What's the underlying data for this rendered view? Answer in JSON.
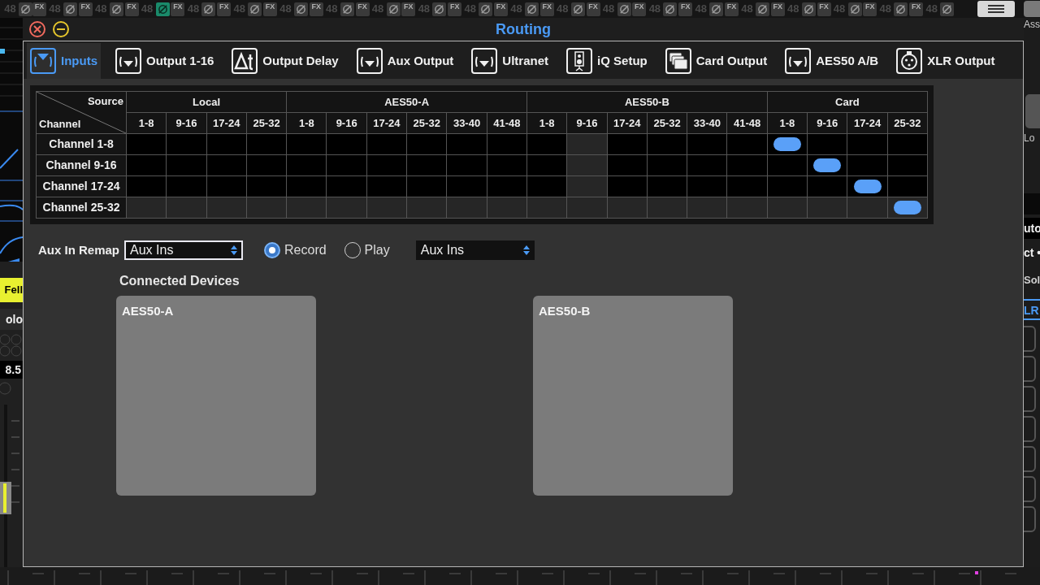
{
  "mixer_top": {
    "strips": [
      {
        "kind": "partial",
        "gain": "48",
        "phase_on": false
      },
      {
        "kind": "full",
        "fx": "FX",
        "gain": "48",
        "phase_on": false
      },
      {
        "kind": "full",
        "fx": "FX",
        "gain": "48",
        "phase_on": false
      },
      {
        "kind": "full",
        "fx": "FX",
        "gain": "48",
        "phase_on": true
      },
      {
        "kind": "full",
        "fx": "FX",
        "gain": "48",
        "phase_on": false
      },
      {
        "kind": "full",
        "fx": "FX",
        "gain": "48",
        "phase_on": false
      },
      {
        "kind": "full",
        "fx": "FX",
        "gain": "48",
        "phase_on": false
      },
      {
        "kind": "full",
        "fx": "FX",
        "gain": "48",
        "phase_on": false
      },
      {
        "kind": "full",
        "fx": "FX",
        "gain": "48",
        "phase_on": false
      },
      {
        "kind": "full",
        "fx": "FX",
        "gain": "48",
        "phase_on": false
      },
      {
        "kind": "full",
        "fx": "FX",
        "gain": "48",
        "phase_on": false
      },
      {
        "kind": "full",
        "fx": "FX",
        "gain": "48",
        "phase_on": false
      },
      {
        "kind": "full",
        "fx": "FX",
        "gain": "48",
        "phase_on": false
      },
      {
        "kind": "full",
        "fx": "FX",
        "gain": "48",
        "phase_on": false
      },
      {
        "kind": "full",
        "fx": "FX",
        "gain": "48",
        "phase_on": false
      },
      {
        "kind": "full",
        "fx": "FX",
        "gain": "48",
        "phase_on": false
      },
      {
        "kind": "full",
        "fx": "FX",
        "gain": "48",
        "phase_on": false
      },
      {
        "kind": "full",
        "fx": "FX",
        "gain": "48",
        "phase_on": false
      },
      {
        "kind": "full",
        "fx": "FX",
        "gain": "48",
        "phase_on": false
      },
      {
        "kind": "full",
        "fx": "FX",
        "gain": "48",
        "phase_on": false
      },
      {
        "kind": "full",
        "fx": "FX",
        "gain": "48",
        "phase_on": false
      }
    ]
  },
  "left_strip": {
    "channel_name": "Fell",
    "solo": "olo",
    "reading": "8.5"
  },
  "right_strip": {
    "assign": "Ass",
    "load": "Lo",
    "auto": "uto",
    "select": "ct •",
    "solo": "Sol",
    "bus": "LR"
  },
  "window": {
    "title": "Routing",
    "tabs": [
      {
        "label": "Inputs",
        "selected": true
      },
      {
        "label": "Output 1-16",
        "selected": false
      },
      {
        "label": "Output Delay",
        "selected": false
      },
      {
        "label": "Aux Output",
        "selected": false
      },
      {
        "label": "Ultranet",
        "selected": false
      },
      {
        "label": "iQ Setup",
        "selected": false
      },
      {
        "label": "Card Output",
        "selected": false
      },
      {
        "label": "AES50 A/B",
        "selected": false
      },
      {
        "label": "XLR Output",
        "selected": false
      }
    ],
    "matrix": {
      "corner": {
        "source": "Source",
        "channel": "Channel"
      },
      "groups": [
        {
          "label": "Local",
          "columns": [
            {
              "label": "1-8",
              "disabled": false
            },
            {
              "label": "9-16",
              "disabled": false
            },
            {
              "label": "17-24",
              "disabled": false
            },
            {
              "label": "25-32",
              "disabled": false
            }
          ]
        },
        {
          "label": "AES50-A",
          "columns": [
            {
              "label": "1-8",
              "disabled": false
            },
            {
              "label": "9-16",
              "disabled": false
            },
            {
              "label": "17-24",
              "disabled": false
            },
            {
              "label": "25-32",
              "disabled": false
            },
            {
              "label": "33-40",
              "disabled": false
            },
            {
              "label": "41-48",
              "disabled": false
            }
          ]
        },
        {
          "label": "AES50-B",
          "columns": [
            {
              "label": "1-8",
              "disabled": false
            },
            {
              "label": "9-16",
              "disabled": true
            },
            {
              "label": "17-24",
              "disabled": false
            },
            {
              "label": "25-32",
              "disabled": false
            },
            {
              "label": "33-40",
              "disabled": false
            },
            {
              "label": "41-48",
              "disabled": false
            }
          ]
        },
        {
          "label": "Card",
          "columns": [
            {
              "label": "1-8",
              "disabled": false
            },
            {
              "label": "9-16",
              "disabled": false
            },
            {
              "label": "17-24",
              "disabled": false
            },
            {
              "label": "25-32",
              "disabled": false
            }
          ]
        }
      ],
      "rows": [
        {
          "label": "Channel 1-8",
          "disabled": false,
          "cells": [
            false,
            false,
            false,
            false,
            false,
            false,
            false,
            false,
            false,
            false,
            false,
            false,
            false,
            false,
            false,
            false,
            true,
            false,
            false,
            false
          ]
        },
        {
          "label": "Channel 9-16",
          "disabled": false,
          "cells": [
            false,
            false,
            false,
            false,
            false,
            false,
            false,
            false,
            false,
            false,
            false,
            false,
            false,
            false,
            false,
            false,
            false,
            true,
            false,
            false
          ]
        },
        {
          "label": "Channel 17-24",
          "disabled": false,
          "cells": [
            false,
            false,
            false,
            false,
            false,
            false,
            false,
            false,
            false,
            false,
            false,
            false,
            false,
            false,
            false,
            false,
            false,
            false,
            true,
            false
          ]
        },
        {
          "label": "Channel 25-32",
          "disabled": true,
          "cells": [
            false,
            false,
            false,
            false,
            false,
            false,
            false,
            false,
            false,
            false,
            false,
            false,
            false,
            false,
            false,
            false,
            false,
            false,
            false,
            true
          ]
        }
      ]
    },
    "aux_remap": {
      "label": "Aux In Remap",
      "value": "Aux Ins",
      "modes": [
        {
          "label": "Record",
          "selected": true
        },
        {
          "label": "Play",
          "selected": false
        }
      ],
      "target": "Aux Ins"
    },
    "connected_devices": {
      "title": "Connected Devices",
      "devices": [
        {
          "name": "AES50-A"
        },
        {
          "name": "AES50-B"
        }
      ]
    }
  }
}
